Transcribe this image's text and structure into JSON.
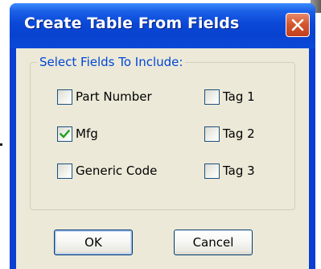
{
  "dialog": {
    "title": "Create Table From Fields"
  },
  "group": {
    "legend": "Select Fields To Include:"
  },
  "fields": [
    {
      "label": "Part Number",
      "checked": false
    },
    {
      "label": "Tag 1",
      "checked": false
    },
    {
      "label": "Mfg",
      "checked": true
    },
    {
      "label": "Tag 2",
      "checked": false
    },
    {
      "label": "Generic Code",
      "checked": false
    },
    {
      "label": "Tag 3",
      "checked": false
    }
  ],
  "buttons": {
    "ok_label": "OK",
    "cancel_label": "Cancel"
  },
  "colors": {
    "title_bar": "#0842cf",
    "close_button": "#d4572f",
    "dialog_face": "#ece9d8",
    "legend_text": "#0046d5",
    "checkmark": "#21a121"
  },
  "icons": {
    "close": "close-icon",
    "check": "checkmark-icon"
  }
}
